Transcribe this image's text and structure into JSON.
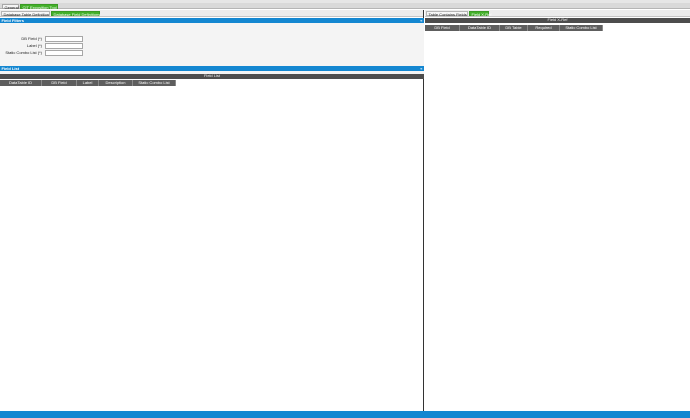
{
  "tabs": {
    "general": "General",
    "cit": "CIT Exposition Tool"
  },
  "left": {
    "subtabs": {
      "table_def": "Database Table Definition",
      "field_defs": "Database Field Definitions"
    },
    "field_filters": {
      "title": "Field Filters",
      "collapse": "«",
      "rows": [
        {
          "label": "DB Field (*)",
          "value": ""
        },
        {
          "label": "Label (*)",
          "value": ""
        },
        {
          "label": "Static Combo List (*)",
          "value": ""
        }
      ]
    },
    "field_list": {
      "title": "Field List",
      "collapse": "«",
      "caption": "Field List",
      "columns": [
        "DataTable ID",
        "DB Field",
        "Label",
        "Description",
        "Static Combo List"
      ]
    }
  },
  "right": {
    "subtabs": {
      "table_contains": "Table Contains Fields",
      "field_xref": "Field X-Ref"
    },
    "xref": {
      "caption": "Field X-Ref",
      "columns": [
        "DB Field",
        "DataTable ID",
        "DB Table",
        "Required",
        "Static Combo List"
      ]
    }
  },
  "colors": {
    "accent_blue": "#1487d1",
    "accent_green": "#43b02a",
    "grid_header": "#5e5e5e"
  }
}
